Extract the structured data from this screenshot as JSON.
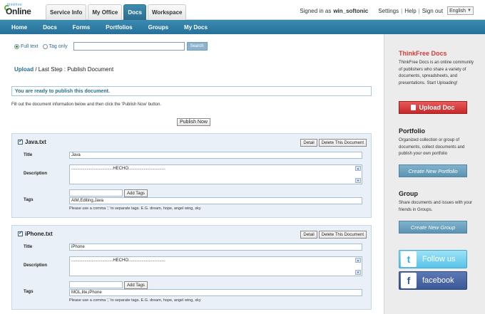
{
  "header": {
    "logo_small": "thinkfree",
    "logo_big": "Online",
    "tabs": [
      {
        "label": "Service Info",
        "active": false
      },
      {
        "label": "My Office",
        "active": false
      },
      {
        "label": "Docs",
        "active": true
      },
      {
        "label": "Workspace",
        "active": false
      }
    ],
    "signed_in_prefix": "Signed in as",
    "username": "win_softonic",
    "links": [
      "Settings",
      "Help",
      "Sign out"
    ],
    "language": "English"
  },
  "nav": [
    "Home",
    "Docs",
    "Forms",
    "Portfolios",
    "Groups",
    "My Docs"
  ],
  "search": {
    "option_fulltext": "Full text",
    "option_tag": "Tag only",
    "value": "",
    "button": "Search"
  },
  "breadcrumb": {
    "link": "Upload",
    "rest": "/ Last Step : Publish Document"
  },
  "ready_message": "You are ready to publish this document.",
  "instructions": "Fill out the document information below and then click the 'Publish Now' button.",
  "publish_button": "Publish Now",
  "labels": {
    "title": "Title",
    "description": "Description",
    "tags": "Tags",
    "add_tags": "Add Tags",
    "detail": "Detail",
    "delete": "Delete This Document",
    "tag_hint": "Please use a comma ',' to separate tags. E.G. dream, hope, angel wing, sky"
  },
  "documents": [
    {
      "filename": "Java.txt",
      "title": "Java",
      "description": "...................................HECHO...............................",
      "tags": "AIM,Editing,Java"
    },
    {
      "filename": "iPhone.txt",
      "title": "iPhone",
      "description": "...................................HECHO...............................",
      "tags": "MOL,lite,iPhone"
    }
  ],
  "sidebar": {
    "intro_title": "ThinkFree Docs",
    "intro_text": "ThinkFree Docs is an online community of publishers who share a variety of documents, spreadsheets, and presentations. Start Uploading!",
    "upload_button": "Upload Doc",
    "portfolio_title": "Portfolio",
    "portfolio_text": "Organized collection or group of documents, collect documents and publish your own portfolio",
    "portfolio_button": "Create New Portfolio",
    "group_title": "Group",
    "group_text": "Share documents and issues with your friends in Groups.",
    "group_button": "Create New Group",
    "twitter_label": "Follow us",
    "facebook_label": "facebook"
  },
  "colors": {
    "nav_bg": "#2f7ca3",
    "accent_red": "#d63a3a",
    "link_blue": "#2a6d8f"
  }
}
